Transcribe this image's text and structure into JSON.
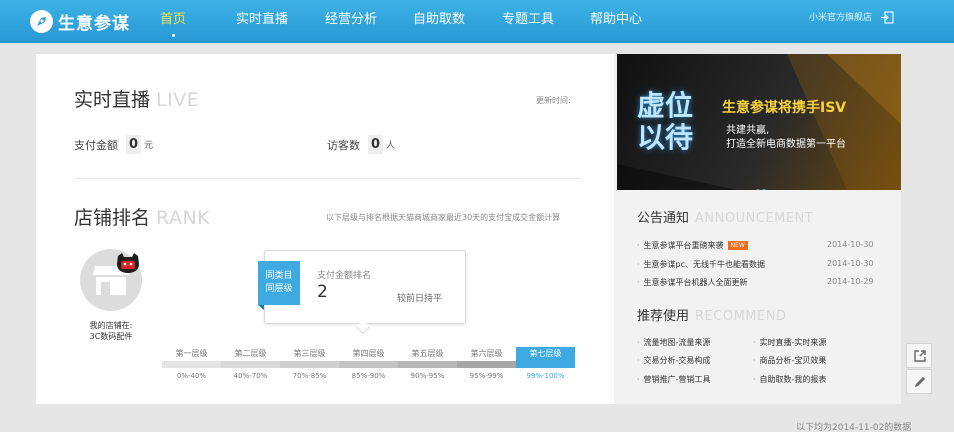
{
  "header": {
    "logo_text": "生意参谋",
    "nav": [
      {
        "label": "首页",
        "active": true
      },
      {
        "label": "实时直播",
        "active": false
      },
      {
        "label": "经营分析",
        "active": false
      },
      {
        "label": "自助取数",
        "active": false
      },
      {
        "label": "专题工具",
        "active": false
      },
      {
        "label": "帮助中心",
        "active": false
      }
    ],
    "shop_name": "小米官方旗舰店",
    "logout_icon": "logout-icon"
  },
  "live": {
    "title": "实时直播",
    "title_en": "LIVE",
    "update_label": "更新时间:",
    "pay_label": "支付金额",
    "pay_value": "0",
    "pay_unit": "元",
    "visitor_label": "访客数",
    "visitor_value": "0",
    "visitor_unit": "人"
  },
  "rank": {
    "title": "店铺排名",
    "title_en": "RANK",
    "note": "以下层级与排名根据天猫商城商家最近30天的支付宝成交金额计算",
    "store_caption_line1": "我的店铺在:",
    "store_caption_line2": "3C数码配件",
    "tag_line1": "同类目",
    "tag_line2": "同层级",
    "card_label": "支付金额排名",
    "card_value": "2",
    "card_note": "较前日持平",
    "tiers": [
      {
        "name": "第一层级",
        "range": "0%-40%",
        "color": "#e4e4e4"
      },
      {
        "name": "第二层级",
        "range": "40%-70%",
        "color": "#dadada"
      },
      {
        "name": "第三层级",
        "range": "70%-85%",
        "color": "#cfcfcf"
      },
      {
        "name": "第四层级",
        "range": "85%-90%",
        "color": "#c3c3c3"
      },
      {
        "name": "第五层级",
        "range": "90%-95%",
        "color": "#b6b6b6"
      },
      {
        "name": "第六层级",
        "range": "95%-99%",
        "color": "#a7a7a7"
      },
      {
        "name": "第七层级",
        "range": "99%-100%",
        "color": "#3fa9e2",
        "active": true
      }
    ]
  },
  "banner": {
    "big_text": "虚位以待",
    "title": "生意参谋将携手ISV",
    "sub_line1": "共建共赢,",
    "sub_line2": "打造全新电商数据第一平台"
  },
  "announcement": {
    "title": "公告通知",
    "title_en": "ANNOUNCEMENT",
    "items": [
      {
        "text": "生意参谋平台重磅来袭",
        "date": "2014-10-30",
        "badge": "NEW"
      },
      {
        "text": "生意参谋pc、无线千牛也能看数据",
        "date": "2014-10-30"
      },
      {
        "text": "生意参谋平台机器人全面更新",
        "date": "2014-10-29"
      }
    ]
  },
  "recommend": {
    "title": "推荐使用",
    "title_en": "RECOMMEND",
    "items": [
      "流量地图-流量来源",
      "实时直播-实时来源",
      "交易分析-交易构成",
      "商品分析-宝贝效果",
      "营销推广-营销工具",
      "自助取数-我的报表"
    ]
  },
  "tools": {
    "share_icon": "share-icon",
    "edit_icon": "edit-icon"
  },
  "footnote": "以下均为2014-11-02的数据"
}
